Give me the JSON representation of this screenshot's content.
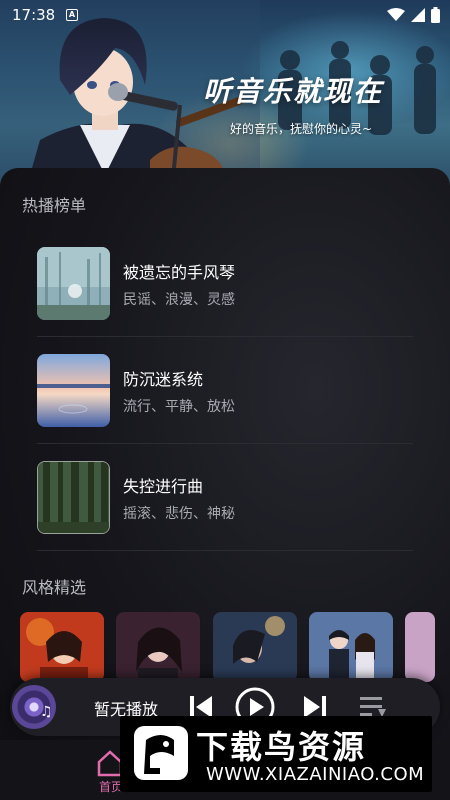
{
  "status_bar": {
    "time": "17:38",
    "notification_badge": "A"
  },
  "hero": {
    "title": "听音乐就现在",
    "subtitle": "好的音乐，抚慰你的心灵~"
  },
  "hot_list": {
    "title": "热播榜单",
    "songs": [
      {
        "name": "被遗忘的手风琴",
        "tags": "民谣、浪漫、灵感",
        "cover_icon": "misty-forest-cover"
      },
      {
        "name": "防沉迷系统",
        "tags": "流行、平静、放松",
        "cover_icon": "sunset-lake-cover"
      },
      {
        "name": "失控进行曲",
        "tags": "摇滚、悲伤、神秘",
        "cover_icon": "dark-forest-cover"
      }
    ]
  },
  "style_picks": {
    "title": "风格精选",
    "cards": [
      "singer-red-cover",
      "woman-portrait-cover",
      "profile-blue-cover",
      "couple-cover",
      "partial-cover"
    ]
  },
  "player": {
    "now_playing": "暂无播放"
  },
  "bottom_nav": {
    "home_label": "首页"
  },
  "watermark": {
    "brand": "下载鸟资源",
    "url": "WWW.XIAZAINIAO.COM"
  },
  "colors": {
    "accent": "#e06cae",
    "background": "#0e0e12",
    "muted_text": "#a9a9b2"
  }
}
